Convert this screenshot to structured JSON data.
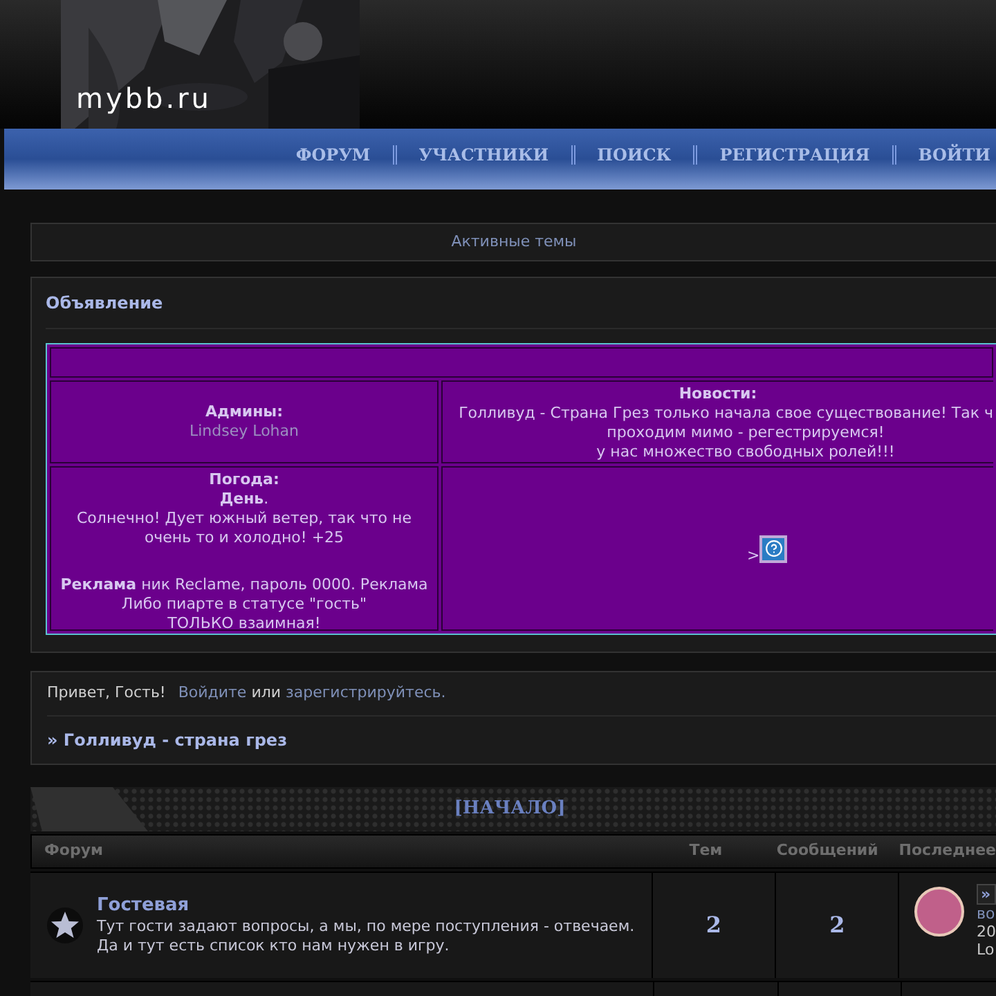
{
  "header": {
    "logo": "mybb.ru"
  },
  "nav": [
    {
      "label": "ФОРУМ"
    },
    {
      "label": "УЧАСТНИКИ"
    },
    {
      "label": "ПОИСК"
    },
    {
      "label": "РЕГИСТРАЦИЯ"
    },
    {
      "label": "ВОЙТИ"
    }
  ],
  "active_topics": "Активные темы",
  "announcement": {
    "title": "Объявление",
    "admins_label": "Админы:",
    "admins_value": "Lindsey Lohan",
    "news_label": "Новости:",
    "news_lines": [
      "Голливуд - Страна Грез только начала свое существование! Так ч",
      "проходим мимо - регестрируемся!",
      "у нас множество свободных ролей!!!"
    ],
    "weather_label": "Погода:",
    "weather_time": "**День**.",
    "weather_text": "Солнечно! Дует южный ветер, так что не очень то и холодно! +25",
    "ad_lines": [
      "**Реклама** ник Reclame, пароль 0000. Реклама",
      "Либо пиарте в статусе \"гость\"",
      "ТОЛЬКО взаимная!"
    ],
    "image_prefix": ">"
  },
  "greeting": {
    "hello": "Привет, Гость!",
    "login": "Войдите",
    "or": "или",
    "register": "зарегистрируйтесь."
  },
  "breadcrumb": "» Голливуд - страна грез",
  "category": {
    "title": "[НАЧАЛО]",
    "columns": [
      "Форум",
      "Тем",
      "Сообщений",
      "Последнее"
    ],
    "forums": [
      {
        "title": "Гостевая",
        "description": "Тут гости задают вопросы, а мы, по мере поступления - отвечаем. Да и тут есть список кто нам нужен в игру.",
        "topics": "2",
        "posts": "2",
        "last_link": "»",
        "last_lines": [
          "во",
          "20",
          "Lo"
        ]
      }
    ]
  }
}
